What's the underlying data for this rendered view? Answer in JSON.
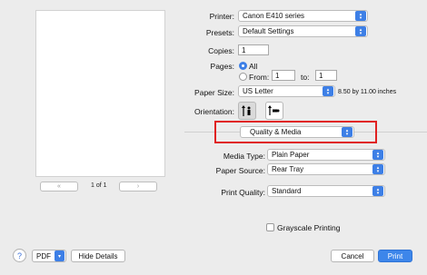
{
  "preview": {
    "page_indicator": "1 of 1",
    "first_label": "«",
    "prev_label": "‹",
    "next_label": "›",
    "last_label": "»"
  },
  "printer": {
    "label": "Printer:",
    "value": "Canon E410 series"
  },
  "presets": {
    "label": "Presets:",
    "value": "Default Settings"
  },
  "copies": {
    "label": "Copies:",
    "value": "1"
  },
  "pages": {
    "label": "Pages:",
    "all_label": "All",
    "from_label": "From:",
    "from_value": "1",
    "to_label": "to:",
    "to_value": "1",
    "selected": "All"
  },
  "paper_size": {
    "label": "Paper Size:",
    "value": "US Letter",
    "dimensions": "8.50 by 11.00 inches"
  },
  "orientation": {
    "label": "Orientation:",
    "selected": "portrait"
  },
  "section_popup": {
    "value": "Quality & Media"
  },
  "media_type": {
    "label": "Media Type:",
    "value": "Plain Paper"
  },
  "paper_source": {
    "label": "Paper Source:",
    "value": "Rear Tray"
  },
  "print_quality": {
    "label": "Print Quality:",
    "value": "Standard"
  },
  "grayscale": {
    "label": "Grayscale Printing",
    "checked": false
  },
  "footer": {
    "help_label": "?",
    "pdf_label": "PDF",
    "hide_details_label": "Hide Details",
    "cancel_label": "Cancel",
    "print_label": "Print"
  },
  "colors": {
    "accent": "#3d7fe6",
    "highlight": "#e02020"
  }
}
